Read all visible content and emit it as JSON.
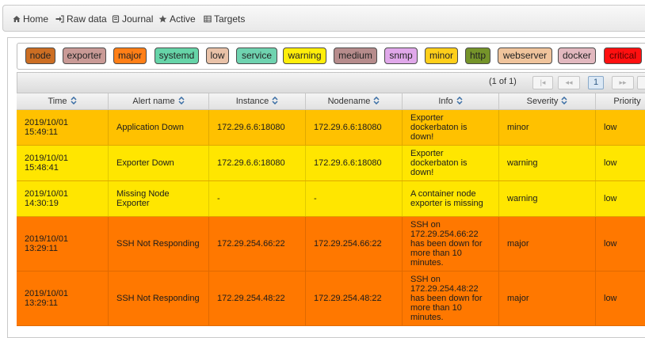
{
  "nav": {
    "home": "Home",
    "raw_data": "Raw data",
    "journal": "Journal",
    "active": "Active",
    "targets": "Targets"
  },
  "tags": [
    {
      "label": "node",
      "color": "#cc6e23"
    },
    {
      "label": "exporter",
      "color": "#c99a96"
    },
    {
      "label": "major",
      "color": "#ff7f17"
    },
    {
      "label": "systemd",
      "color": "#66d4a8"
    },
    {
      "label": "low",
      "color": "#e9c2a8"
    },
    {
      "label": "service",
      "color": "#6fd3b0"
    },
    {
      "label": "warning",
      "color": "#ffee0a"
    },
    {
      "label": "medium",
      "color": "#b68c8c"
    },
    {
      "label": "snmp",
      "color": "#e0a8ea"
    },
    {
      "label": "minor",
      "color": "#ffcf1a"
    },
    {
      "label": "http",
      "color": "#75942a"
    },
    {
      "label": "webserver",
      "color": "#f0c49c"
    },
    {
      "label": "docker",
      "color": "#e2b8bf"
    },
    {
      "label": "critical",
      "color": "#ff1010"
    }
  ],
  "paginator": {
    "count": "(1 of 1)",
    "first": "|◂",
    "prev": "◂◂",
    "page": "1",
    "next": "▸▸"
  },
  "table": {
    "columns": [
      "Time",
      "Alert name",
      "Instance",
      "Nodename",
      "Info",
      "Severity",
      "Priority"
    ],
    "rows": [
      {
        "time": "2019/10/01 15:49:11",
        "alert": "Application Down",
        "instance": "172.29.6.6:18080",
        "nodename": "172.29.6.6:18080",
        "info": "Exporter dockerbaton is down!",
        "severity": "minor",
        "priority": "low",
        "color": "#ffc100"
      },
      {
        "time": "2019/10/01 15:48:41",
        "alert": "Exporter Down",
        "instance": "172.29.6.6:18080",
        "nodename": "172.29.6.6:18080",
        "info": "Exporter dockerbaton is down!",
        "severity": "warning",
        "priority": "low",
        "color": "#ffe600"
      },
      {
        "time": "2019/10/01 14:30:19",
        "alert": "Missing Node Exporter",
        "instance": "-",
        "nodename": "-",
        "info": "A container node exporter is missing",
        "severity": "warning",
        "priority": "low",
        "color": "#ffe600"
      },
      {
        "time": "2019/10/01 13:29:11",
        "alert": "SSH Not Responding",
        "instance": "172.29.254.66:22",
        "nodename": "172.29.254.66:22",
        "info": "SSH on 172.29.254.66:22 has been down for more than 10 minutes.",
        "severity": "major",
        "priority": "low",
        "color": "#ff7800"
      },
      {
        "time": "2019/10/01 13:29:11",
        "alert": "SSH Not Responding",
        "instance": "172.29.254.48:22",
        "nodename": "172.29.254.48:22",
        "info": "SSH on 172.29.254.48:22 has been down for more than 10 minutes.",
        "severity": "major",
        "priority": "low",
        "color": "#ff7800"
      }
    ]
  }
}
